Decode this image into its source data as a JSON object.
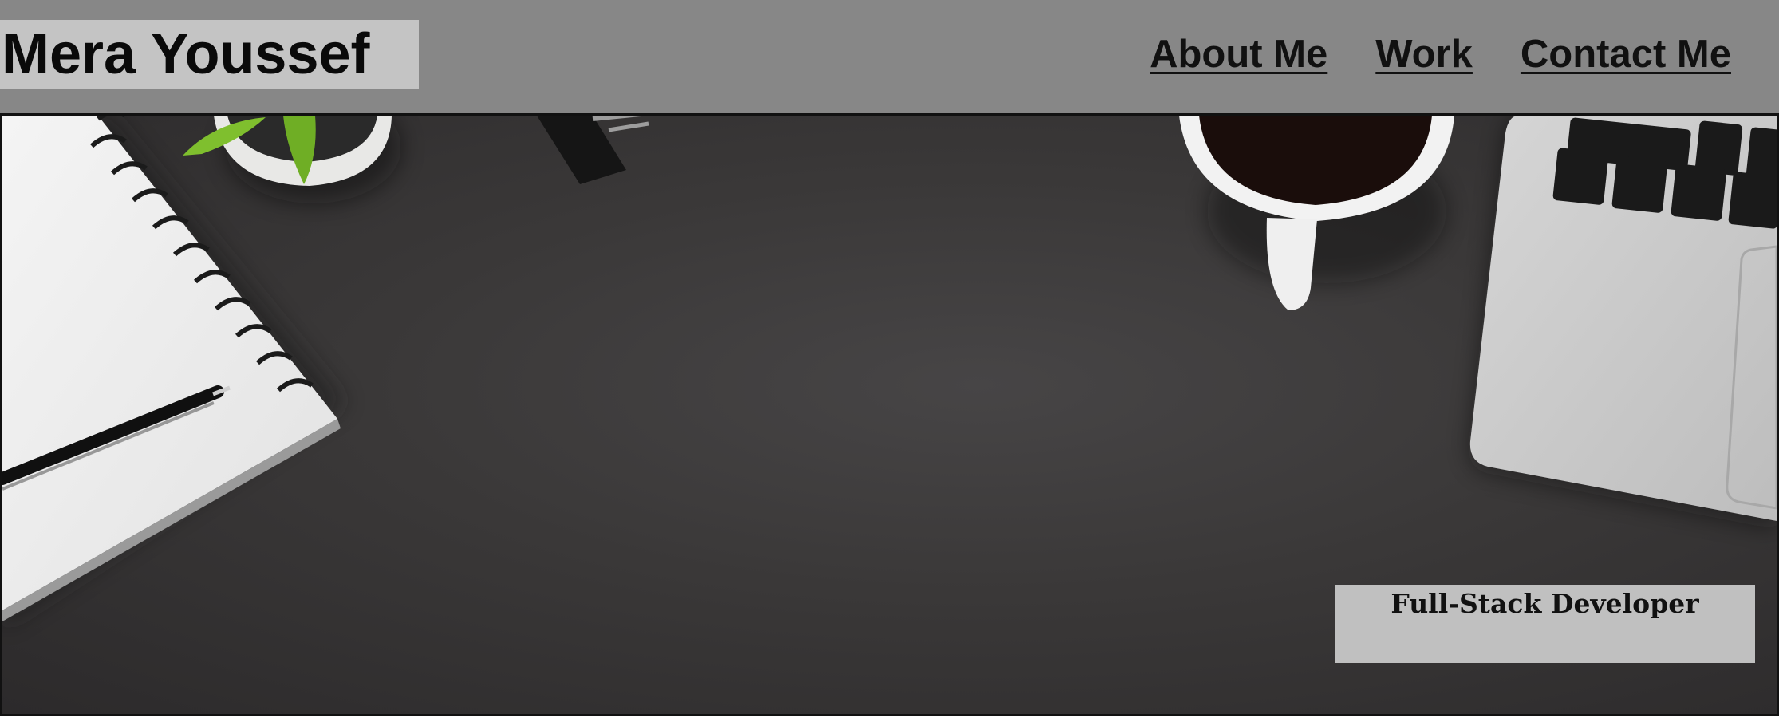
{
  "header": {
    "brand_name": "Mera Youssef",
    "nav": [
      {
        "label": "About Me"
      },
      {
        "label": "Work"
      },
      {
        "label": "Contact Me"
      }
    ]
  },
  "hero": {
    "image_alt": "desk-with-notebook-pen-plant-coffee-laptop",
    "tagline": "Full-Stack Developer"
  },
  "colors": {
    "header_bg": "#878787",
    "brand_bg": "#c4c4c4",
    "desk": "#3a3838",
    "tagline_bg": "#c0c0c0"
  }
}
